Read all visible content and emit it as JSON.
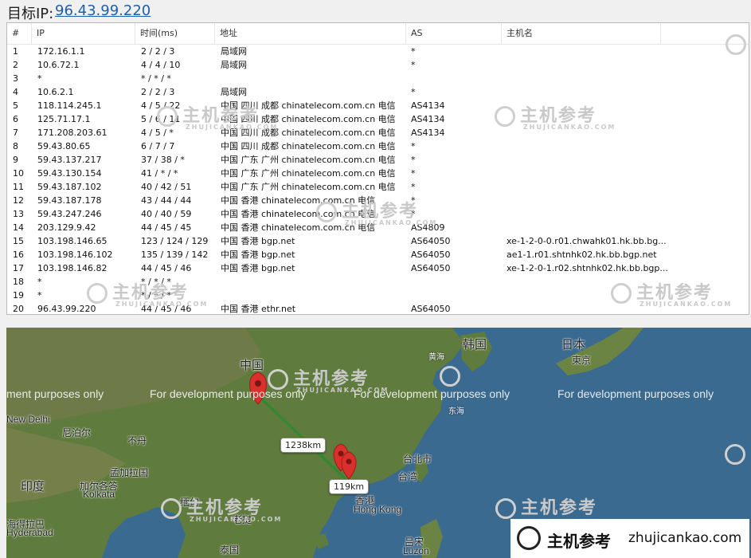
{
  "header": {
    "label": "目标IP:",
    "ip": "96.43.99.220"
  },
  "columns": [
    "#",
    "IP",
    "时间(ms)",
    "地址",
    "AS",
    "主机名"
  ],
  "rows": [
    [
      "1",
      "172.16.1.1",
      "2 / 2 / 3",
      "局域网",
      "*",
      ""
    ],
    [
      "2",
      "10.6.72.1",
      "4 / 4 / 10",
      "局域网",
      "*",
      ""
    ],
    [
      "3",
      "*",
      "* / * / *",
      "",
      "",
      ""
    ],
    [
      "4",
      "10.6.2.1",
      "2 / 2 / 3",
      "局域网",
      "*",
      ""
    ],
    [
      "5",
      "118.114.245.1",
      "4 / 5 / 22",
      "中国 四川 成都 chinatelecom.com.cn 电信",
      "AS4134",
      ""
    ],
    [
      "6",
      "125.71.17.1",
      "5 / 6 / 11",
      "中国 四川 成都 chinatelecom.com.cn 电信",
      "AS4134",
      ""
    ],
    [
      "7",
      "171.208.203.61",
      "4 / 5 / *",
      "中国 四川 成都 chinatelecom.com.cn 电信",
      "AS4134",
      ""
    ],
    [
      "8",
      "59.43.80.65",
      "6 / 7 / 7",
      "中国 四川 成都 chinatelecom.com.cn 电信",
      "*",
      ""
    ],
    [
      "9",
      "59.43.137.217",
      "37 / 38 / *",
      "中国 广东 广州 chinatelecom.com.cn 电信",
      "*",
      ""
    ],
    [
      "10",
      "59.43.130.154",
      "41 / * / *",
      "中国 广东 广州 chinatelecom.com.cn 电信",
      "*",
      ""
    ],
    [
      "11",
      "59.43.187.102",
      "40 / 42 / 51",
      "中国 广东 广州 chinatelecom.com.cn 电信",
      "*",
      ""
    ],
    [
      "12",
      "59.43.187.178",
      "43 / 44 / 44",
      "中国 香港 chinatelecom.com.cn 电信",
      "*",
      ""
    ],
    [
      "13",
      "59.43.247.246",
      "40 / 40 / 59",
      "中国 香港 chinatelecom.com.cn 电信",
      "*",
      ""
    ],
    [
      "14",
      "203.129.9.42",
      "44 / 45 / 45",
      "中国 香港 chinatelecom.com.cn 电信",
      "AS4809",
      ""
    ],
    [
      "15",
      "103.198.146.65",
      "123 / 124 / 129",
      "中国 香港 bgp.net",
      "AS64050",
      "xe-1-2-0-0.r01.chwahk01.hk.bb.bg..."
    ],
    [
      "16",
      "103.198.146.102",
      "135 / 139 / 142",
      "中国 香港 bgp.net",
      "AS64050",
      "ae1-1.r01.shtnhk02.hk.bb.bgp.net"
    ],
    [
      "17",
      "103.198.146.82",
      "44 / 45 / 46",
      "中国 香港 bgp.net",
      "AS64050",
      "xe-1-2-0-1.r02.shtnhk02.hk.bb.bgp..."
    ],
    [
      "18",
      "*",
      "* / * / *",
      "",
      "",
      ""
    ],
    [
      "19",
      "*",
      "* / * / *",
      "",
      "",
      ""
    ],
    [
      "20",
      "96.43.99.220",
      "44 / 45 / 46",
      "中国 香港 ethr.net",
      "AS64050",
      ""
    ]
  ],
  "watermark": {
    "cn": "主机参考",
    "en": "ZHUJICANKAO.COM"
  },
  "map": {
    "dev_notice": "For development purposes only",
    "dev_notice_cut": "ment purposes only",
    "places": {
      "china": "中国",
      "korea": "韩国",
      "japan": "日本",
      "tokyo": "東京",
      "huanghai": "黄海",
      "donghai": "东海",
      "new_delhi": "New Delhi",
      "nepal": "尼泊尔",
      "bhutan": "不丹",
      "bangladesh": "孟加拉国",
      "india": "印度",
      "kolkata_cn": "加尔各答",
      "kolkata": "Kolkata",
      "taipei": "台北市",
      "taiwan": "台湾",
      "hongkong_cn": "香港",
      "hongkong": "Hong Kong",
      "myanmar": "缅甸",
      "laos": "老挝",
      "hyderabad_cn": "海得拉巴",
      "hyderabad": "Hyderabad",
      "thailand": "泰国",
      "luzon_cn": "吕宋",
      "luzon": "Luzon"
    },
    "distances": [
      "1238km",
      "119km"
    ]
  },
  "brand": {
    "cn": "主机参考",
    "url": "zhujicankao.com"
  },
  "colors": {
    "link": "#1a5fb4",
    "sea": "#3a6a8f",
    "land": "#5e7a3c",
    "route": "#2f8a2f",
    "pin": "#d9302b"
  }
}
